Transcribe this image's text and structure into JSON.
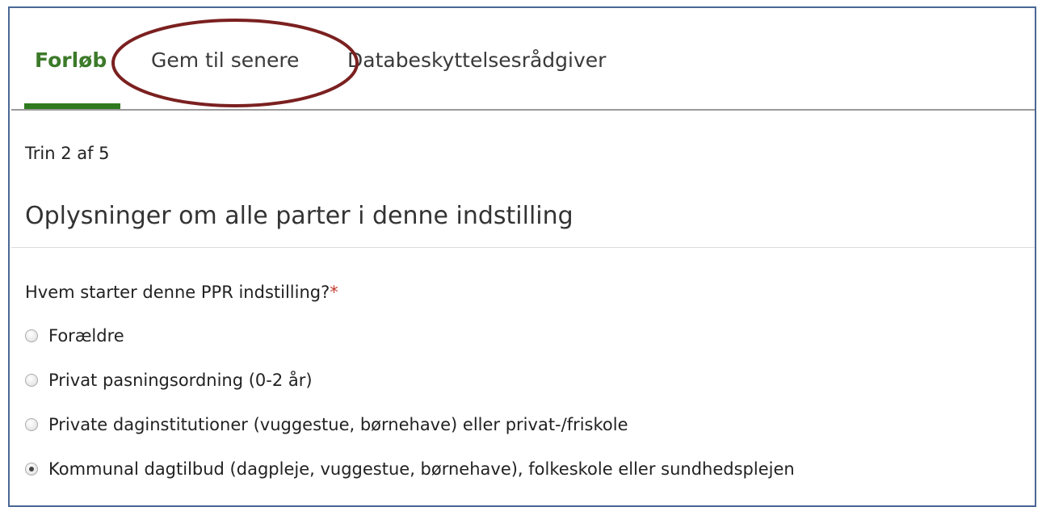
{
  "tabs": [
    {
      "label": "Forløb",
      "active": true
    },
    {
      "label": "Gem til senere",
      "active": false
    },
    {
      "label": "Databeskyttelsesrådgiver",
      "active": false
    }
  ],
  "colors": {
    "active_tab": "#3c7a2a",
    "active_bar": "#2f7a1f",
    "annotation": "#7b2020",
    "required": "#c0392b"
  },
  "step": "Trin 2 af 5",
  "section_title": "Oplysninger om alle parter i denne indstilling",
  "question": {
    "label": "Hvem starter denne PPR indstilling?",
    "required_marker": "*"
  },
  "options": [
    {
      "label": "Forældre",
      "checked": false
    },
    {
      "label": "Privat pasningsordning (0-2 år)",
      "checked": false
    },
    {
      "label": "Private daginstitutioner (vuggestue, børnehave) eller privat-/friskole",
      "checked": false
    },
    {
      "label": "Kommunal dagtilbud (dagpleje, vuggestue, børnehave), folkeskole eller sundhedsplejen",
      "checked": true
    }
  ]
}
